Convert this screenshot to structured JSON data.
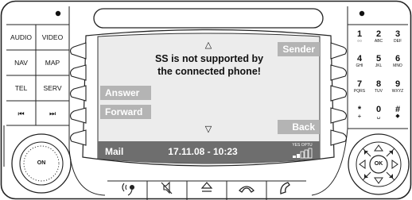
{
  "left_panel": {
    "row1": [
      "AUDIO",
      "VIDEO"
    ],
    "row2": [
      "NAV",
      "MAP"
    ],
    "row3": [
      "TEL",
      "SERV"
    ],
    "row4": [
      "⏮",
      "⏭"
    ],
    "knob_label": "ON"
  },
  "screen": {
    "up_arrow": "△",
    "down_arrow": "▽",
    "message_line1": "SS is not supported by",
    "message_line2": "the connected phone!",
    "softkeys": {
      "sender": "Sender",
      "answer": "Answer",
      "forward": "Forward",
      "back": "Back"
    },
    "status_bar": {
      "app": "Mail",
      "datetime": "17.11.08 - 10:23",
      "operator": "YES OPTU",
      "signal_bars": 2,
      "signal_max": 5
    },
    "colors": {
      "screen_bg": "#ececec",
      "softkey_bg": "#b4b4b4",
      "status_bar_bg": "#6e6e6e"
    }
  },
  "keypad": {
    "keys": [
      {
        "digit": "1",
        "sub": "○○"
      },
      {
        "digit": "2",
        "sub": "ABC"
      },
      {
        "digit": "3",
        "sub": "DEF"
      },
      {
        "digit": "4",
        "sub": "GHI"
      },
      {
        "digit": "5",
        "sub": "JKL"
      },
      {
        "digit": "6",
        "sub": "MNO"
      },
      {
        "digit": "7",
        "sub": "PQRS"
      },
      {
        "digit": "8",
        "sub": "TUV"
      },
      {
        "digit": "9",
        "sub": "WXYZ"
      },
      {
        "digit": "*",
        "sub": "+"
      },
      {
        "digit": "0",
        "sub": "␣"
      },
      {
        "digit": "#",
        "sub": "◆"
      }
    ],
    "ok_label": "OK"
  },
  "bottom_bar": {
    "icons": [
      "voice-icon",
      "mute-icon",
      "eject-icon",
      "hang-up-icon",
      "call-icon"
    ]
  }
}
